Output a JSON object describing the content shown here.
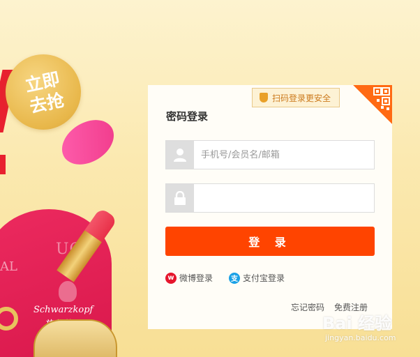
{
  "promo": {
    "badge_line1": "立即",
    "badge_line2": "去抢"
  },
  "brands": {
    "ugg": "UGG",
    "al": "AL",
    "schwarzkopf": "Schwarzkopf",
    "schwarzkopf_cn": "施华蔻"
  },
  "login": {
    "qr_tip": "扫码登录更安全",
    "title": "密码登录",
    "username_placeholder": "手机号/会员名/邮箱",
    "password_placeholder": "",
    "submit_label": "登 录",
    "weibo_label": "微博登录",
    "alipay_label": "支付宝登录",
    "forgot_label": "忘记密码",
    "register_label": "免费注册"
  },
  "colors": {
    "accent": "#ff4400",
    "background": "#fbe7a6",
    "weibo": "#e6162d",
    "alipay": "#1aa1e6"
  },
  "icons": {
    "user": "user-icon",
    "lock": "lock-icon",
    "shield": "shield-icon",
    "qr": "qr-code-icon"
  },
  "watermark": {
    "text": "Bai 经验",
    "url": "jingyan.baidu.com"
  }
}
